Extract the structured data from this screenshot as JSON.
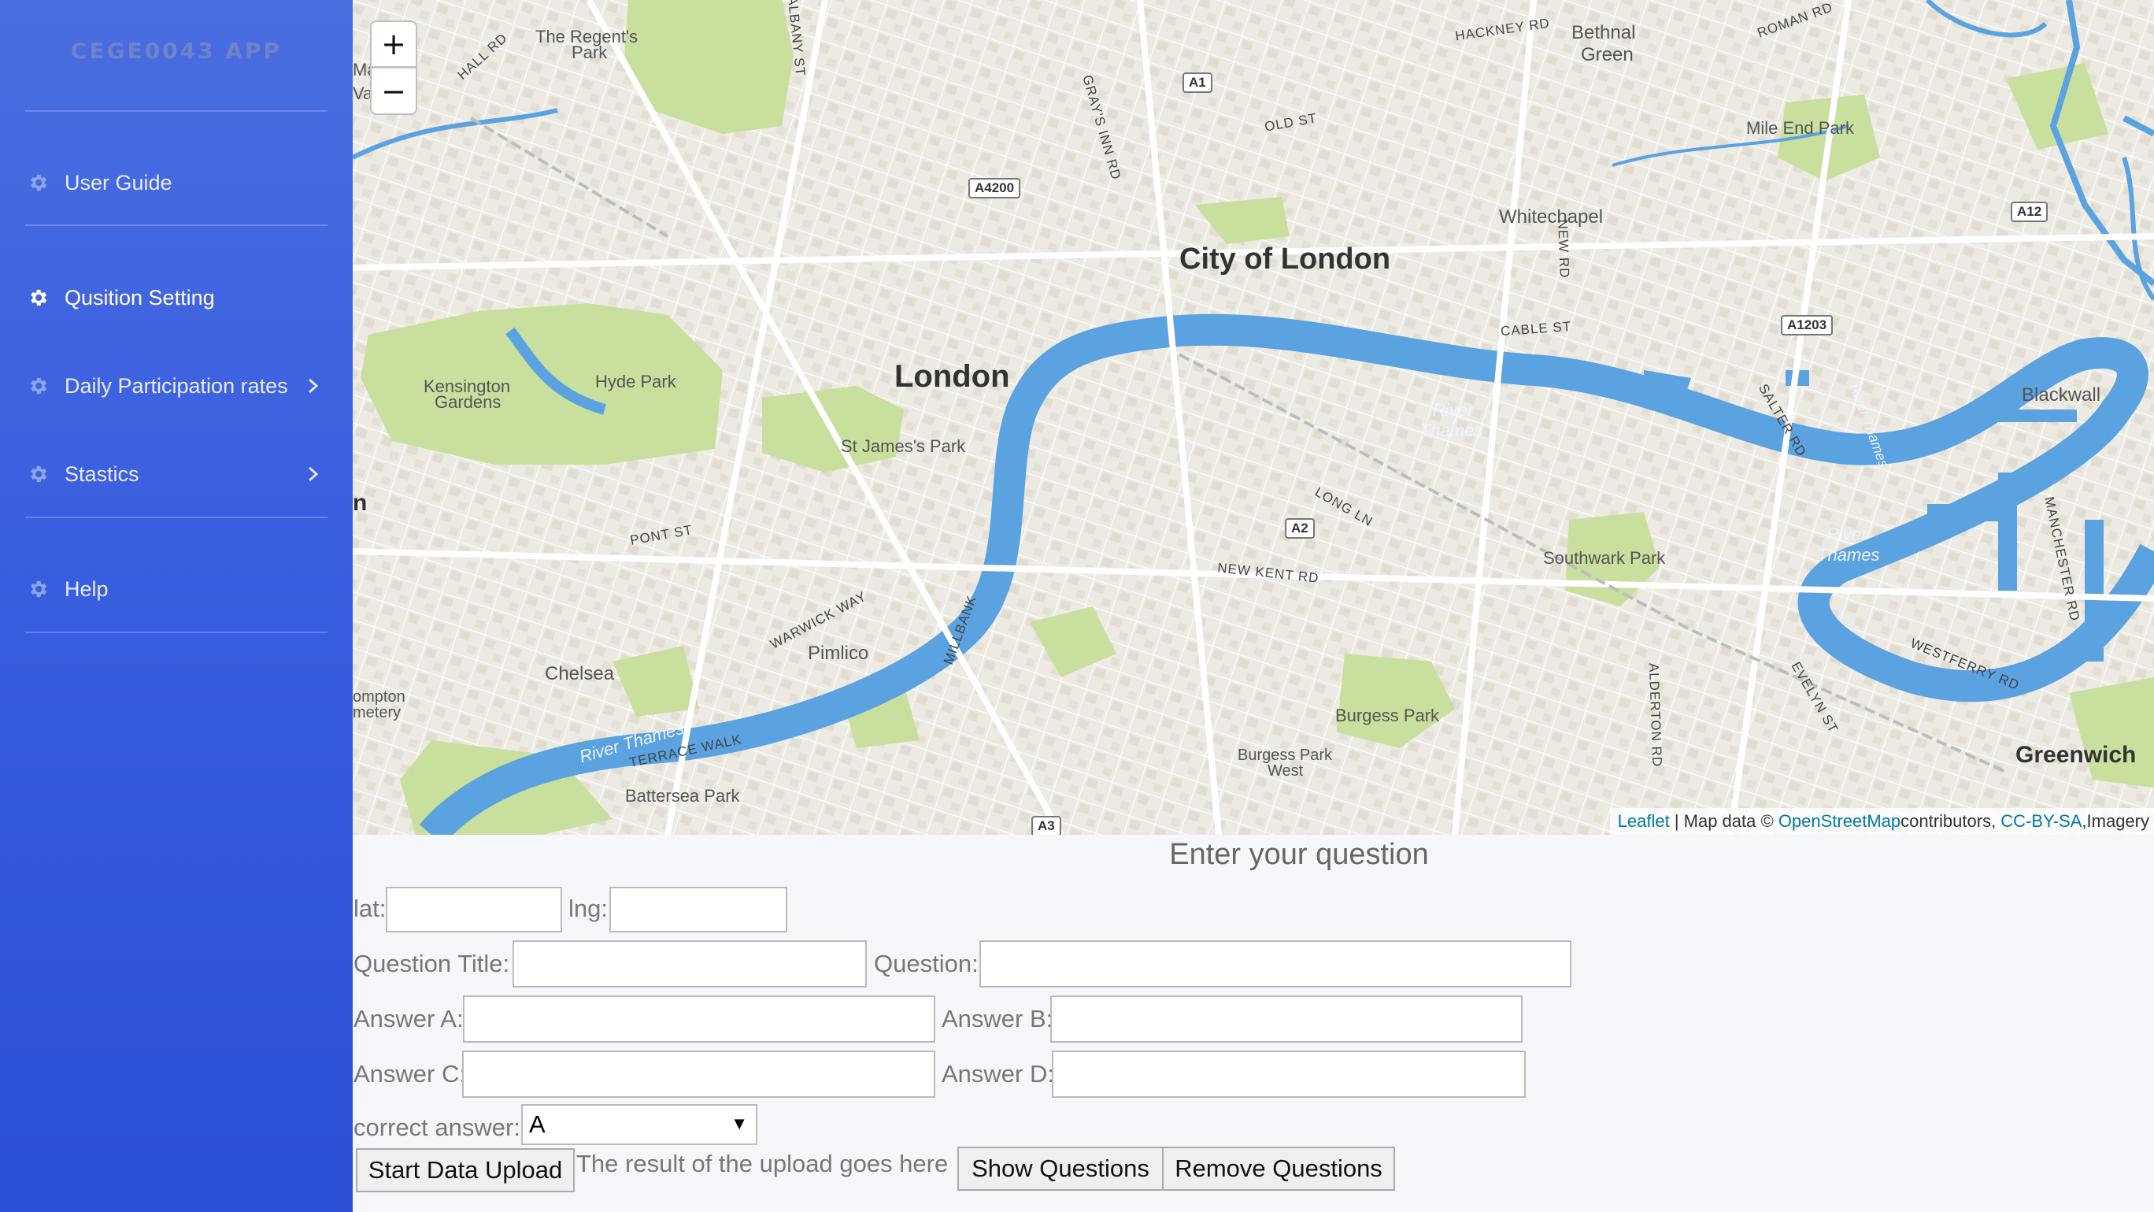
{
  "app": {
    "brand": "CEGE0043 APP"
  },
  "sidebar": {
    "items": [
      {
        "label": "User Guide",
        "icon": "gear-icon",
        "has_submenu": false
      },
      {
        "label": "Qusition Setting",
        "icon": "gear-icon",
        "has_submenu": false,
        "active": true
      },
      {
        "label": "Daily Participation rates",
        "icon": "gear-icon",
        "has_submenu": true
      },
      {
        "label": "Stastics",
        "icon": "gear-icon",
        "has_submenu": true
      },
      {
        "label": "Help",
        "icon": "gear-icon",
        "has_submenu": false
      }
    ]
  },
  "map": {
    "zoom_in": "+",
    "zoom_out": "−",
    "attribution": {
      "leaflet": "Leaflet",
      "sep": " | Map data © ",
      "osm": "OpenStreetMap",
      "contrib": "contributors, ",
      "license": "CC-BY-SA",
      "imagery": ",Imagery"
    },
    "labels": {
      "london": "London",
      "city": "City of London",
      "regents": "The Regent's",
      "regents2": "Park",
      "hyde": "Hyde Park",
      "kensington": "Kensington",
      "kensington2": "Gardens",
      "stjames": "St James's Park",
      "pimlico": "Pimlico",
      "chelsea": "Chelsea",
      "battersea": "Battersea Park",
      "whitechapel": "Whitechapel",
      "bethnal": "Bethnal",
      "bethnal2": "Green",
      "mileend": "Mile End Park",
      "blackwall": "Blackwall",
      "southwark": "Southwark Park",
      "burgess": "Burgess Park",
      "burgessw": "Burgess Park",
      "burgessw2": "West",
      "greenwich": "Greenwich",
      "thames1": "River",
      "thames1b": "Thames",
      "thames2": "River Thames",
      "thames3": "River",
      "thames3b": "Thames",
      "riverthames_v": "River Thames",
      "hackney": "HACKNEY RD",
      "roman": "ROMAN RD",
      "oldst": "OLD ST",
      "cable": "CABLE ST",
      "salter": "SALTER RD",
      "longln": "LONG LN",
      "newkent": "NEW KENT RD",
      "pontst": "PONT ST",
      "warwick": "WARWICK WAY",
      "millbank": "MILLBANK",
      "terrace": "TERRACE WALK",
      "westferry": "WESTFERRY RD",
      "evelyn": "EVELYN ST",
      "alderton": "ALDERTON RD",
      "manchester": "MANCHESTER RD",
      "grays": "GRAY'S INN RD",
      "albany": "ALBANY ST",
      "hallrd": "HALL RD",
      "newrd": "NEW RD",
      "cemetery": "ompton",
      "cemetery2": "metery",
      "edge_n": "n",
      "edge_ma": "Ma",
      "edge_va": "Va"
    },
    "shields": [
      "A1",
      "A4200",
      "A1203",
      "A12",
      "A2",
      "A3"
    ]
  },
  "form": {
    "title": "Enter your question",
    "lat_label": "lat:",
    "lng_label": "lng:",
    "question_title_label": "Question Title:",
    "question_label": "Question:",
    "answer_a_label": "Answer A:",
    "answer_b_label": "Answer B:",
    "answer_c_label": "Answer C:",
    "answer_d_label": "Answer D:",
    "correct_label": "correct answer:",
    "correct_value": "A",
    "upload_button": "Start Data Upload",
    "upload_result": "The result of the upload goes here",
    "show_button": "Show Questions",
    "remove_button": "Remove Questions"
  },
  "colors": {
    "sidebar_top": "#4a6ee0",
    "sidebar_bottom": "#2c4fd8",
    "water": "#5aa2e0",
    "park": "#c8df9d",
    "land": "#eceae3",
    "link": "#0078a8"
  }
}
